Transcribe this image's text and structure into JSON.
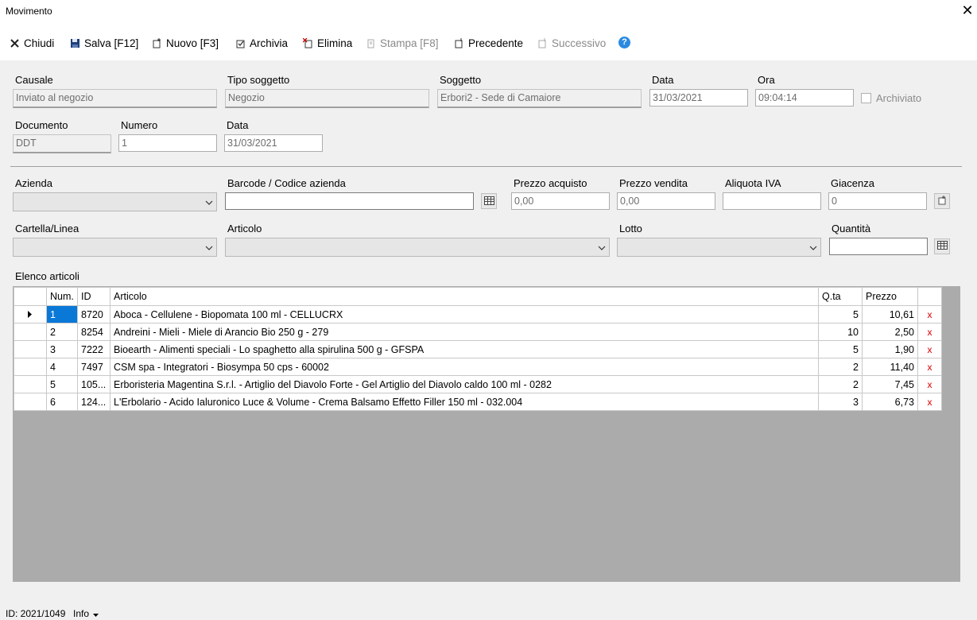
{
  "window": {
    "title": "Movimento"
  },
  "toolbar": {
    "chiudi": "Chiudi",
    "salva": "Salva [F12]",
    "nuovo": "Nuovo [F3]",
    "archivia": "Archivia",
    "elimina": "Elimina",
    "stampa": "Stampa [F8]",
    "precedente": "Precedente",
    "successivo": "Successivo"
  },
  "form": {
    "causale": {
      "label": "Causale",
      "value": "Inviato al negozio"
    },
    "tipo_soggetto": {
      "label": "Tipo soggetto",
      "value": "Negozio"
    },
    "soggetto": {
      "label": "Soggetto",
      "value": "Erbori2  - Sede di Camaiore"
    },
    "data": {
      "label": "Data",
      "value": "31/03/2021"
    },
    "ora": {
      "label": "Ora",
      "value": "09:04:14"
    },
    "archiviato": {
      "label": "Archiviato"
    },
    "documento": {
      "label": "Documento",
      "value": "DDT"
    },
    "numero": {
      "label": "Numero",
      "value": "1"
    },
    "data_doc": {
      "label": "Data",
      "value": "31/03/2021"
    }
  },
  "entry": {
    "azienda": {
      "label": "Azienda",
      "value": ""
    },
    "barcode": {
      "label": "Barcode / Codice azienda",
      "value": ""
    },
    "prezzo_acquisto": {
      "label": "Prezzo acquisto",
      "value": "0,00"
    },
    "prezzo_vendita": {
      "label": "Prezzo vendita",
      "value": "0,00"
    },
    "aliquota_iva": {
      "label": "Aliquota IVA",
      "value": ""
    },
    "giacenza": {
      "label": "Giacenza",
      "value": "0"
    },
    "cartella": {
      "label": "Cartella/Linea",
      "value": ""
    },
    "articolo": {
      "label": "Articolo",
      "value": ""
    },
    "lotto": {
      "label": "Lotto",
      "value": ""
    },
    "quantita": {
      "label": "Quantità",
      "value": ""
    }
  },
  "elenco": {
    "label": "Elenco articoli",
    "columns": {
      "num": "Num.",
      "id": "ID",
      "articolo": "Articolo",
      "qta": "Q.ta",
      "prezzo": "Prezzo"
    },
    "rows": [
      {
        "num": "1",
        "id": "8720",
        "articolo": "Aboca - Cellulene - Biopomata 100 ml - CELLUCRX",
        "qta": "5",
        "prezzo": "10,61",
        "del": "x"
      },
      {
        "num": "2",
        "id": "8254",
        "articolo": "Andreini - Mieli - Miele di Arancio Bio 250 g - 279",
        "qta": "10",
        "prezzo": "2,50",
        "del": "x"
      },
      {
        "num": "3",
        "id": "7222",
        "articolo": "Bioearth - Alimenti speciali - Lo spaghetto alla spirulina 500 g - GFSPA",
        "qta": "5",
        "prezzo": "1,90",
        "del": "x"
      },
      {
        "num": "4",
        "id": "7497",
        "articolo": "CSM spa - Integratori - Biosympa 50 cps - 60002",
        "qta": "2",
        "prezzo": "11,40",
        "del": "x"
      },
      {
        "num": "5",
        "id": "105...",
        "articolo": "Erboristeria Magentina S.r.l. - Artiglio del Diavolo Forte - Gel Artiglio del Diavolo caldo 100 ml - 0282",
        "qta": "2",
        "prezzo": "7,45",
        "del": "x"
      },
      {
        "num": "6",
        "id": "124...",
        "articolo": "L'Erbolario - Acido Ialuronico Luce & Volume - Crema Balsamo Effetto Filler 150 ml - 032.004",
        "qta": "3",
        "prezzo": "6,73",
        "del": "x"
      }
    ]
  },
  "status": {
    "id": "ID: 2021/1049",
    "info": "Info"
  },
  "colors": {
    "accent": "#0a78d7",
    "delete": "#e00000",
    "grid_bg": "#ababab"
  }
}
